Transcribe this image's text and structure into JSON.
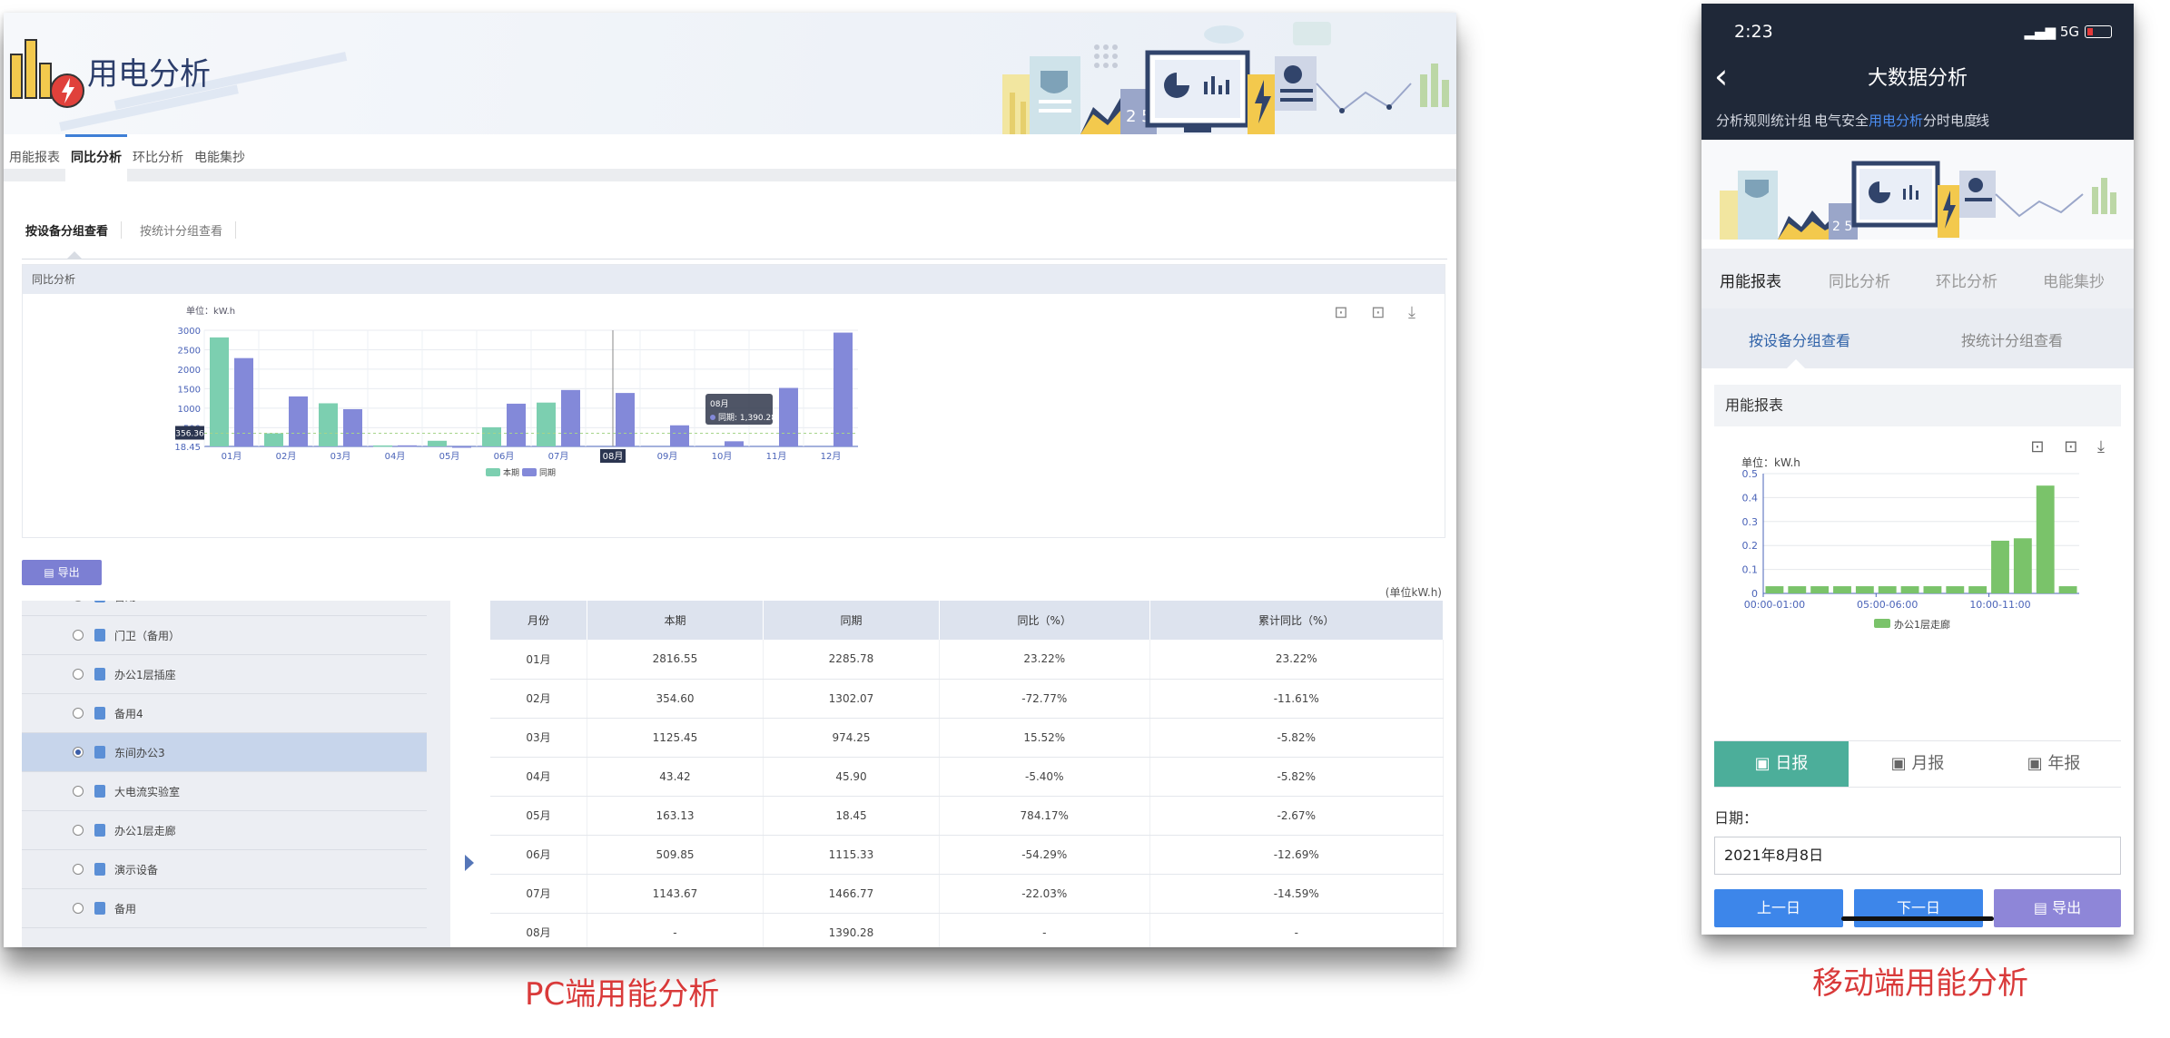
{
  "pc": {
    "title": "用电分析",
    "tabs": [
      "用能报表",
      "同比分析",
      "环比分析",
      "电能集抄"
    ],
    "active_tab": 1,
    "subtabs": [
      "按设备分组查看",
      "按统计分组查看"
    ],
    "panel_title": "同比分析",
    "tools": "⊡ ⊡ ⤓",
    "export_label": "导出",
    "unit_note": "(单位kW.h)",
    "tree_items": [
      {
        "label": "备用",
        "selected": false
      },
      {
        "label": "门卫（备用）",
        "selected": false
      },
      {
        "label": "办公1层插座",
        "selected": false
      },
      {
        "label": "备用4",
        "selected": false
      },
      {
        "label": "东间办公3",
        "selected": true
      },
      {
        "label": "大电流实验室",
        "selected": false
      },
      {
        "label": "办公1层走廊",
        "selected": false
      },
      {
        "label": "演示设备",
        "selected": false
      },
      {
        "label": "备用",
        "selected": false
      }
    ],
    "table": {
      "headers": [
        "月份",
        "本期",
        "同期",
        "同比（%）",
        "累计同比（%）"
      ],
      "rows": [
        [
          "01月",
          "2816.55",
          "2285.78",
          "23.22%",
          "23.22%"
        ],
        [
          "02月",
          "354.60",
          "1302.07",
          "-72.77%",
          "-11.61%"
        ],
        [
          "03月",
          "1125.45",
          "974.25",
          "15.52%",
          "-5.82%"
        ],
        [
          "04月",
          "43.42",
          "45.90",
          "-5.40%",
          "-5.82%"
        ],
        [
          "05月",
          "163.13",
          "18.45",
          "784.17%",
          "-2.67%"
        ],
        [
          "06月",
          "509.85",
          "1115.33",
          "-54.29%",
          "-12.69%"
        ],
        [
          "07月",
          "1143.67",
          "1466.77",
          "-22.03%",
          "-14.59%"
        ],
        [
          "08月",
          "-",
          "1390.28",
          "-",
          "-"
        ]
      ]
    },
    "caption": "PC端用能分析"
  },
  "chart_data": [
    {
      "type": "bar",
      "ylabel": "单位：kW.h",
      "categories": [
        "01月",
        "02月",
        "03月",
        "04月",
        "05月",
        "06月",
        "07月",
        "08月",
        "09月",
        "10月",
        "11月",
        "12月"
      ],
      "series": [
        {
          "name": "本期",
          "values": [
            2816.55,
            354.6,
            1125.45,
            43.42,
            163.13,
            509.85,
            1143.67,
            null,
            null,
            null,
            null,
            null
          ],
          "color": "#7ccfb0"
        },
        {
          "name": "同期",
          "values": [
            2285.78,
            1302.07,
            974.25,
            45.9,
            18.45,
            1115.33,
            1466.77,
            1390.28,
            560,
            150,
            1520,
            2940
          ],
          "color": "#8389d9"
        }
      ],
      "ylim": [
        18.45,
        3000
      ],
      "yticks": [
        "3000",
        "2500",
        "2000",
        "1500",
        "1000",
        "500",
        "18.45"
      ],
      "marker_label": "356.36",
      "marker_value": 356.36,
      "tooltip": {
        "category": "08月",
        "title": "08月",
        "line": "同期: 1,390.28"
      },
      "legend": "bottom"
    },
    {
      "type": "bar",
      "ylabel": "单位：kW.h",
      "categories": [
        "00:00-01:00",
        "01:00-02:00",
        "02:00-03:00",
        "03:00-04:00",
        "04:00-05:00",
        "05:00-06:00",
        "06:00-07:00",
        "07:00-08:00",
        "08:00-09:00",
        "09:00-10:00",
        "10:00-11:00",
        "11:00-12:00",
        "12:00-13:00",
        "13:00-14:00"
      ],
      "tick_labels": [
        "00:00-01:00",
        "05:00-06:00",
        "10:00-11:00"
      ],
      "series": [
        {
          "name": "办公1层走廊",
          "values": [
            0.03,
            0.03,
            0.03,
            0.03,
            0.03,
            0.03,
            0.03,
            0.03,
            0.03,
            0.03,
            0.22,
            0.23,
            0.45,
            0.03
          ],
          "color": "#7ac36a"
        }
      ],
      "ylim": [
        0,
        0.5
      ],
      "yticks": [
        "0.5",
        "0.4",
        "0.3",
        "0.2",
        "0.1",
        "0"
      ],
      "legend": "bottom"
    }
  ],
  "mobile": {
    "time": "2:23",
    "signal": "5G",
    "title": "大数据分析",
    "nav": [
      "分析规则",
      "统计组",
      "电气安全",
      "用电分析",
      "分时电度",
      "线"
    ],
    "nav_active": 3,
    "tabs": [
      "用能报表",
      "同比分析",
      "环比分析",
      "电能集抄"
    ],
    "subtabs": [
      "按设备分组查看",
      "按统计分组查看"
    ],
    "report_title": "用能报表",
    "tools": "⊡ ⊡ ⤓",
    "periods": [
      "日报",
      "月报",
      "年报"
    ],
    "date_label": "日期：",
    "date_value": "2021年8月8日",
    "buttons": {
      "prev": "上一日",
      "next": "下一日",
      "export": "导出"
    },
    "caption": "移动端用能分析"
  },
  "colors": {
    "accent": "#3f7fd6",
    "current": "#7ccfb0",
    "previous": "#8389d9",
    "mobile_bar": "#7ac36a",
    "caption": "#d93a3a"
  }
}
